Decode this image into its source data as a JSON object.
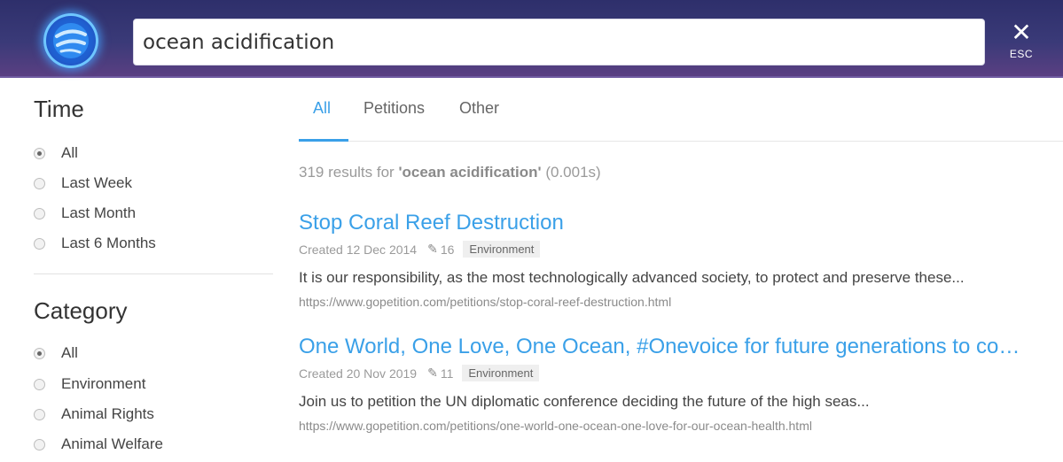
{
  "search": {
    "query": "ocean acidification",
    "close_icon": "close-icon",
    "close_label": "ESC"
  },
  "sidebar": {
    "time": {
      "title": "Time",
      "options": [
        {
          "label": "All",
          "selected": true
        },
        {
          "label": "Last Week",
          "selected": false
        },
        {
          "label": "Last Month",
          "selected": false
        },
        {
          "label": "Last 6 Months",
          "selected": false
        }
      ]
    },
    "category": {
      "title": "Category",
      "options": [
        {
          "label": "All",
          "selected": true
        },
        {
          "label": "Environment",
          "selected": false
        },
        {
          "label": "Animal Rights",
          "selected": false
        },
        {
          "label": "Animal Welfare",
          "selected": false
        }
      ]
    }
  },
  "tabs": [
    {
      "label": "All",
      "active": true
    },
    {
      "label": "Petitions",
      "active": false
    },
    {
      "label": "Other",
      "active": false
    }
  ],
  "summary": {
    "count": "319 results for",
    "query": "'ocean acidification'",
    "time": "(0.001s)"
  },
  "results": [
    {
      "title": "Stop Coral Reef Destruction",
      "created": "Created 12 Dec 2014",
      "edits": "16",
      "tag": "Environment",
      "snippet": "It is our responsibility, as the most technologically advanced society, to protect and preserve these...",
      "url": "https://www.gopetition.com/petitions/stop-coral-reef-destruction.html"
    },
    {
      "title": "One World, One Love, One Ocean, #Onevoice for future generations to com...",
      "created": "Created 20 Nov 2019",
      "edits": "11",
      "tag": "Environment",
      "snippet": "Join us to petition the UN diplomatic conference deciding the future of the high seas...",
      "url": "https://www.gopetition.com/petitions/one-world-one-ocean-one-love-for-our-ocean-health.html"
    }
  ],
  "colors": {
    "accent": "#3aa0e8",
    "header": "#3a3a78"
  }
}
